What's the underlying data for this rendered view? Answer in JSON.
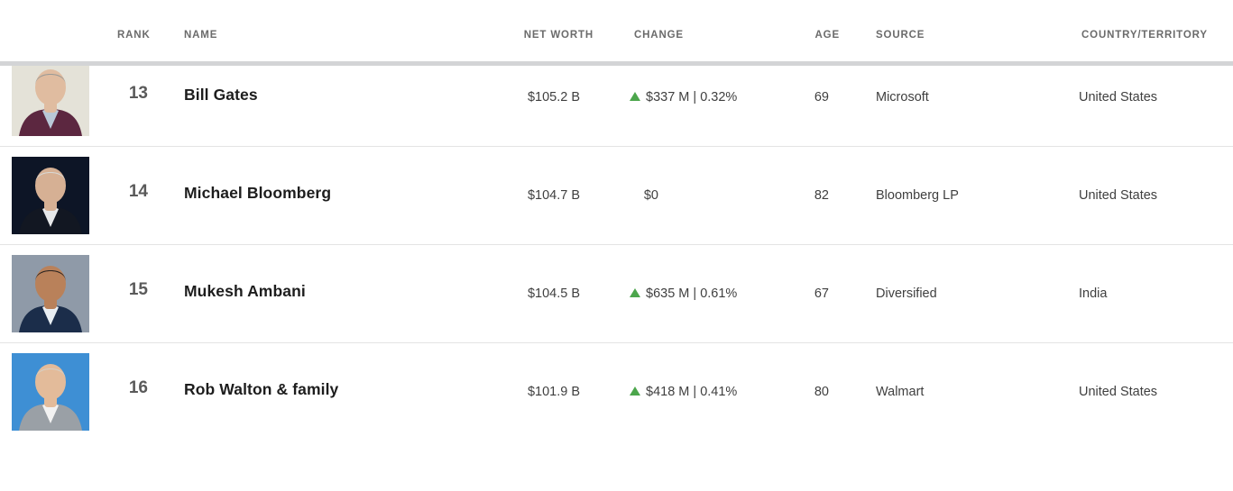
{
  "table": {
    "columns": [
      {
        "key": "rank",
        "label": "RANK"
      },
      {
        "key": "name",
        "label": "NAME"
      },
      {
        "key": "worth",
        "label": "NET WORTH"
      },
      {
        "key": "change",
        "label": "CHANGE"
      },
      {
        "key": "age",
        "label": "AGE"
      },
      {
        "key": "source",
        "label": "SOURCE"
      },
      {
        "key": "country",
        "label": "COUNTRY/TERRITORY"
      }
    ],
    "colors": {
      "change_up": "#4CA64C",
      "change_down": "#d0463b",
      "header_text": "#6b6b6b",
      "rule": "#d3d4d6",
      "row_divider": "#e4e4e4",
      "name_text": "#1d1d1d"
    },
    "rows": [
      {
        "rank": "",
        "name": "",
        "worth": "",
        "change": "",
        "change_dir": "none",
        "age": "",
        "source": "",
        "country": "",
        "partial": true,
        "photo": {
          "bg": "#0b1020",
          "skin": "#c9a48a",
          "hair": "#cfd3d8",
          "suit": "#10131c",
          "shirt": "#b9c6d6"
        }
      },
      {
        "rank": "13",
        "name": "Bill Gates",
        "worth": "$105.2 B",
        "change": "$337 M | 0.32%",
        "change_dir": "up",
        "age": "69",
        "source": "Microsoft",
        "country": "United States",
        "partial": false,
        "photo": {
          "bg": "#e4e2d8",
          "skin": "#e0bca0",
          "hair": "#9a9a96",
          "suit": "#5c2740",
          "shirt": "#b9c8d8"
        }
      },
      {
        "rank": "14",
        "name": "Michael Bloomberg",
        "worth": "$104.7 B",
        "change": "$0",
        "change_dir": "none",
        "age": "82",
        "source": "Bloomberg LP",
        "country": "United States",
        "partial": false,
        "photo": {
          "bg": "#0d1526",
          "skin": "#d6b094",
          "hair": "#d8d8d4",
          "suit": "#121722",
          "shirt": "#e6e8ea"
        }
      },
      {
        "rank": "15",
        "name": "Mukesh Ambani",
        "worth": "$104.5 B",
        "change": "$635 M | 0.61%",
        "change_dir": "up",
        "age": "67",
        "source": "Diversified",
        "country": "India",
        "partial": false,
        "photo": {
          "bg": "#8f9aa8",
          "skin": "#b9815a",
          "hair": "#2a2320",
          "suit": "#1b2d4a",
          "shirt": "#e8eef3"
        }
      },
      {
        "rank": "16",
        "name": "Rob Walton & family",
        "worth": "$101.9 B",
        "change": "$418 M | 0.41%",
        "change_dir": "up",
        "age": "80",
        "source": "Walmart",
        "country": "United States",
        "partial": false,
        "photo": {
          "bg": "#3e8fd4",
          "skin": "#e3bb9a",
          "hair": "#d6cfc4",
          "suit": "#9aa0a6",
          "shirt": "#f2f2f2"
        }
      }
    ]
  }
}
